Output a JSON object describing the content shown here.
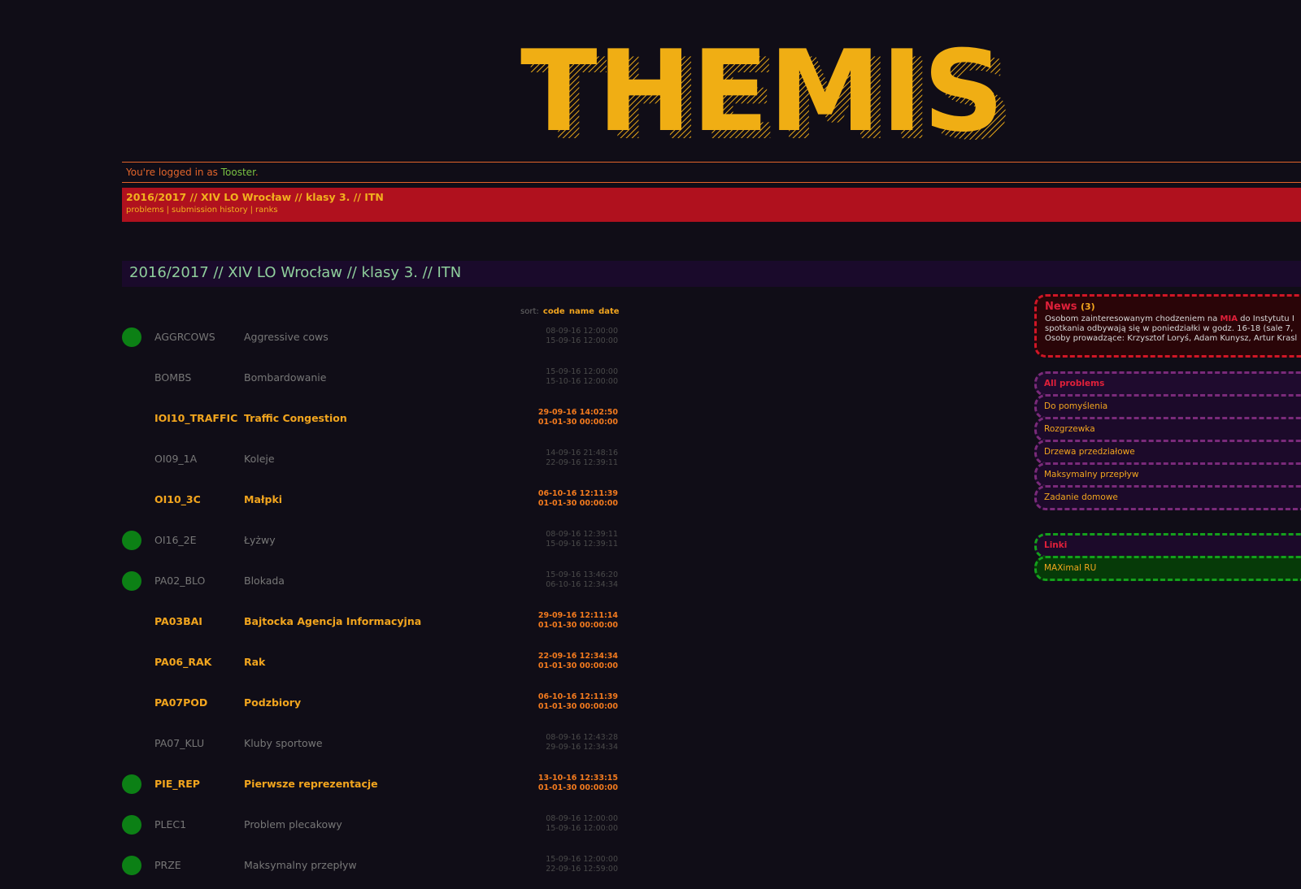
{
  "logo": {
    "text": "THEMIS"
  },
  "login": {
    "prefix": "You're logged in as ",
    "user": "Tooster",
    "suffix": "."
  },
  "course": {
    "title": "2016/2017 // XIV LO Wrocław // klasy 3. // ITN",
    "nav": [
      "problems",
      "submission history",
      "ranks"
    ]
  },
  "page_heading": "2016/2017 // XIV LO Wrocław // klasy 3. // ITN",
  "sort": {
    "label": "sort:",
    "options": [
      "code",
      "name",
      "date"
    ]
  },
  "problems": [
    {
      "code": "AGGRCOWS",
      "name": "Aggressive cows",
      "start": "08-09-16 12:00:00",
      "end": "15-09-16 12:00:00",
      "solved": true,
      "active": false
    },
    {
      "code": "BOMBS",
      "name": "Bombardowanie",
      "start": "15-09-16 12:00:00",
      "end": "15-10-16 12:00:00",
      "solved": false,
      "active": false
    },
    {
      "code": "IOI10_TRAFFIC",
      "name": "Traffic Congestion",
      "start": "29-09-16 14:02:50",
      "end": "01-01-30 00:00:00",
      "solved": false,
      "active": true
    },
    {
      "code": "OI09_1A",
      "name": "Koleje",
      "start": "14-09-16 21:48:16",
      "end": "22-09-16 12:39:11",
      "solved": false,
      "active": false
    },
    {
      "code": "OI10_3C",
      "name": "Małpki",
      "start": "06-10-16 12:11:39",
      "end": "01-01-30 00:00:00",
      "solved": false,
      "active": true
    },
    {
      "code": "OI16_2E",
      "name": "Łyżwy",
      "start": "08-09-16 12:39:11",
      "end": "15-09-16 12:39:11",
      "solved": true,
      "active": false
    },
    {
      "code": "PA02_BLO",
      "name": "Blokada",
      "start": "15-09-16 13:46:20",
      "end": "06-10-16 12:34:34",
      "solved": true,
      "active": false
    },
    {
      "code": "PA03BAI",
      "name": "Bajtocka Agencja Informacyjna",
      "start": "29-09-16 12:11:14",
      "end": "01-01-30 00:00:00",
      "solved": false,
      "active": true
    },
    {
      "code": "PA06_RAK",
      "name": "Rak",
      "start": "22-09-16 12:34:34",
      "end": "01-01-30 00:00:00",
      "solved": false,
      "active": true
    },
    {
      "code": "PA07POD",
      "name": "Podzbiory",
      "start": "06-10-16 12:11:39",
      "end": "01-01-30 00:00:00",
      "solved": false,
      "active": true
    },
    {
      "code": "PA07_KLU",
      "name": "Kluby sportowe",
      "start": "08-09-16 12:43:28",
      "end": "29-09-16 12:34:34",
      "solved": false,
      "active": false
    },
    {
      "code": "PIE_REP",
      "name": "Pierwsze reprezentacje",
      "start": "13-10-16 12:33:15",
      "end": "01-01-30 00:00:00",
      "solved": true,
      "active": true
    },
    {
      "code": "PLEC1",
      "name": "Problem plecakowy",
      "start": "08-09-16 12:00:00",
      "end": "15-09-16 12:00:00",
      "solved": true,
      "active": false
    },
    {
      "code": "PRZE",
      "name": "Maksymalny przepływ",
      "start": "15-09-16 12:00:00",
      "end": "22-09-16 12:59:00",
      "solved": true,
      "active": false
    }
  ],
  "news": {
    "title": "News",
    "count": "(3)",
    "line1_prefix": "Osobom zainteresowanym chodzeniem na ",
    "line1_highlight": "MIA",
    "line1_suffix": " do Instytutu I",
    "line2": "spotkania odbywają się w poniedziałki w godz. 16-18 (sale 7,",
    "line3": "Osoby prowadzące: Krzysztof Loryś, Adam Kunysz, Artur Krasl"
  },
  "categories": {
    "header": "All problems",
    "items": [
      "Do pomyślenia",
      "Rozgrzewka",
      "Drzewa przedziałowe",
      "Maksymalny przepływ",
      "Zadanie domowe"
    ]
  },
  "links": {
    "header": "Linki",
    "items": [
      "MAXimal RU"
    ]
  },
  "colors": {
    "background": "#100d17",
    "accent_orange": "#f2a51e",
    "course_red": "#b0111e",
    "solved_green": "#0c8015"
  }
}
